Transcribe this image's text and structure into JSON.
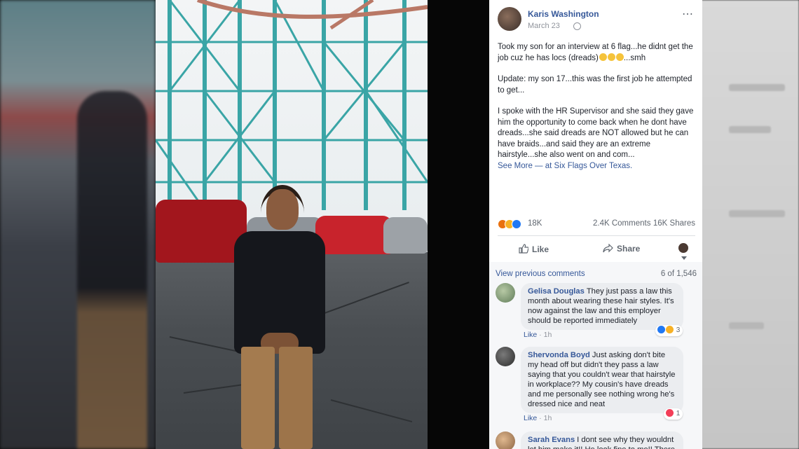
{
  "post": {
    "author": "Karis Washington",
    "date": "March 23",
    "more_icon": "⋯",
    "paragraphs": [
      "Took my son for an interview at 6 flag...he didnt get the job cuz he has locs (dreads)",
      "Update: my son 17...this was the first job he attempted to get...",
      "I spoke with the HR Supervisor and she said they gave him the opportunity to come back when he dont have dreads...she said dreads are NOT allowed but he can have braids...and said they are an extreme hairstyle...she also went on and com..."
    ],
    "p1_suffix": "...smh",
    "see_more": "See More",
    "location_prefix": " — at ",
    "location": "Six Flags Over Texas",
    "location_suffix": "."
  },
  "stats": {
    "reactions": "18K",
    "comments": "2.4K Comments",
    "shares": "16K Shares"
  },
  "actions": {
    "like": "Like",
    "share": "Share"
  },
  "comments_section": {
    "view_previous": "View previous comments",
    "count": "6 of 1,546",
    "items": [
      {
        "name": "Gelisa Douglas",
        "text": "They just pass a law this month about wearing these hair styles. It's now against the law and this employer should be reported immediately",
        "like": "Like",
        "sep": " · ",
        "time": "1h",
        "reactions": "3"
      },
      {
        "name": "Shervonda Boyd",
        "text": "Just asking don't bite my head off but didn't they pass a law saying that you couldn't wear that hairstyle in workplace?? My cousin's have dreads and me personally see nothing wrong he's dressed nice and neat",
        "like": "Like",
        "sep": " · ",
        "time": "1h",
        "reactions": "1"
      },
      {
        "name": "Sarah Evans",
        "text": "I dont see why they wouldnt let him make it!! He look fine to me!! There"
      }
    ]
  },
  "colors": {
    "link": "#365899",
    "ride_structure": "#3aa5a6",
    "car_red": "#a2161d"
  }
}
